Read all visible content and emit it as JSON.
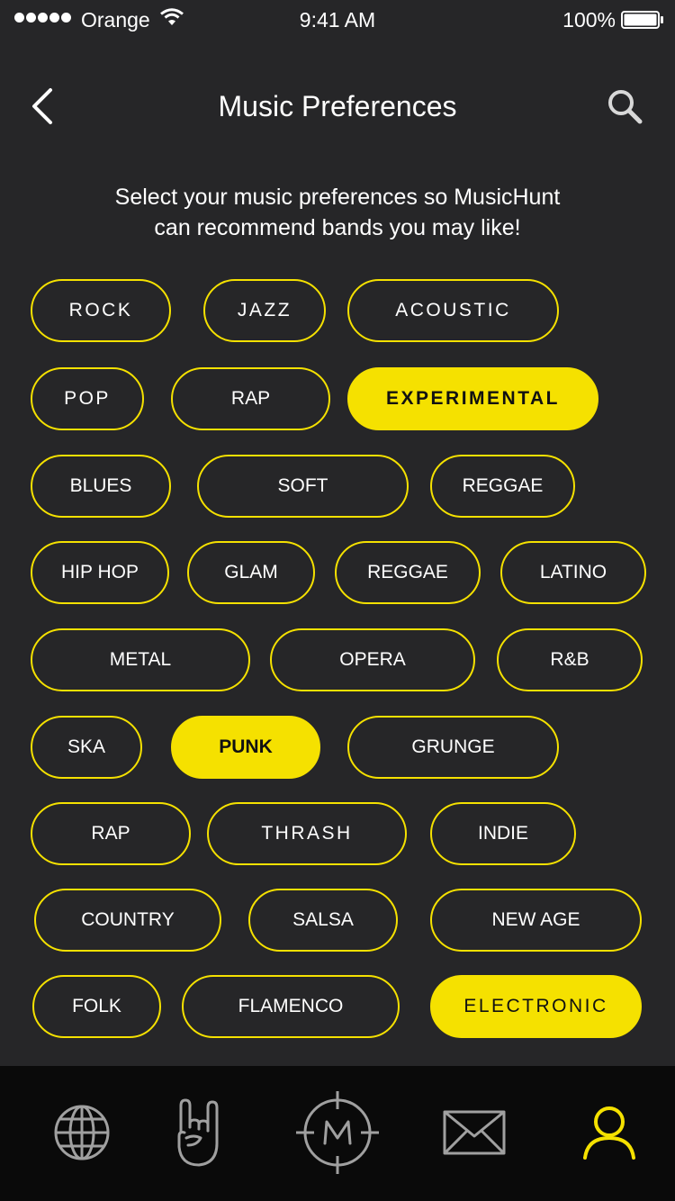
{
  "status_bar": {
    "carrier": "Orange",
    "time": "9:41 AM",
    "battery": "100%"
  },
  "nav": {
    "title": "Music Preferences"
  },
  "intro": {
    "line1": "Select your music preferences so MusicHunt",
    "line2": "can recommend bands you may like!"
  },
  "genres": [
    {
      "label": "ROCK",
      "selected": false
    },
    {
      "label": "JAZZ",
      "selected": false
    },
    {
      "label": "ACOUSTIC",
      "selected": false
    },
    {
      "label": "POP",
      "selected": false
    },
    {
      "label": "RAP",
      "selected": false
    },
    {
      "label": "EXPERIMENTAL",
      "selected": true
    },
    {
      "label": "BLUES",
      "selected": false
    },
    {
      "label": "SOFT",
      "selected": false
    },
    {
      "label": "REGGAE",
      "selected": false
    },
    {
      "label": "HIP HOP",
      "selected": false
    },
    {
      "label": "GLAM",
      "selected": false
    },
    {
      "label": "REGGAE",
      "selected": false
    },
    {
      "label": "LATINO",
      "selected": false
    },
    {
      "label": "METAL",
      "selected": false
    },
    {
      "label": "OPERA",
      "selected": false
    },
    {
      "label": "R&B",
      "selected": false
    },
    {
      "label": "SKA",
      "selected": false
    },
    {
      "label": "PUNK",
      "selected": true
    },
    {
      "label": "GRUNGE",
      "selected": false
    },
    {
      "label": "RAP",
      "selected": false
    },
    {
      "label": "THRASH",
      "selected": false
    },
    {
      "label": "INDIE",
      "selected": false
    },
    {
      "label": "COUNTRY",
      "selected": false
    },
    {
      "label": "SALSA",
      "selected": false
    },
    {
      "label": "NEW AGE",
      "selected": false
    },
    {
      "label": "FOLK",
      "selected": false
    },
    {
      "label": "FLAMENCO",
      "selected": false
    },
    {
      "label": "ELECTRONIC",
      "selected": true
    }
  ],
  "tabs": [
    {
      "icon": "globe-icon",
      "active": false
    },
    {
      "icon": "rock-hand-icon",
      "active": false
    },
    {
      "icon": "musichunt-target-icon",
      "active": false
    },
    {
      "icon": "envelope-icon",
      "active": false
    },
    {
      "icon": "user-icon",
      "active": true
    }
  ],
  "colors": {
    "accent": "#f5e100",
    "background": "#262628",
    "tab_bar": "#0a0a0a",
    "tab_icon_inactive": "#a0a0a0"
  }
}
